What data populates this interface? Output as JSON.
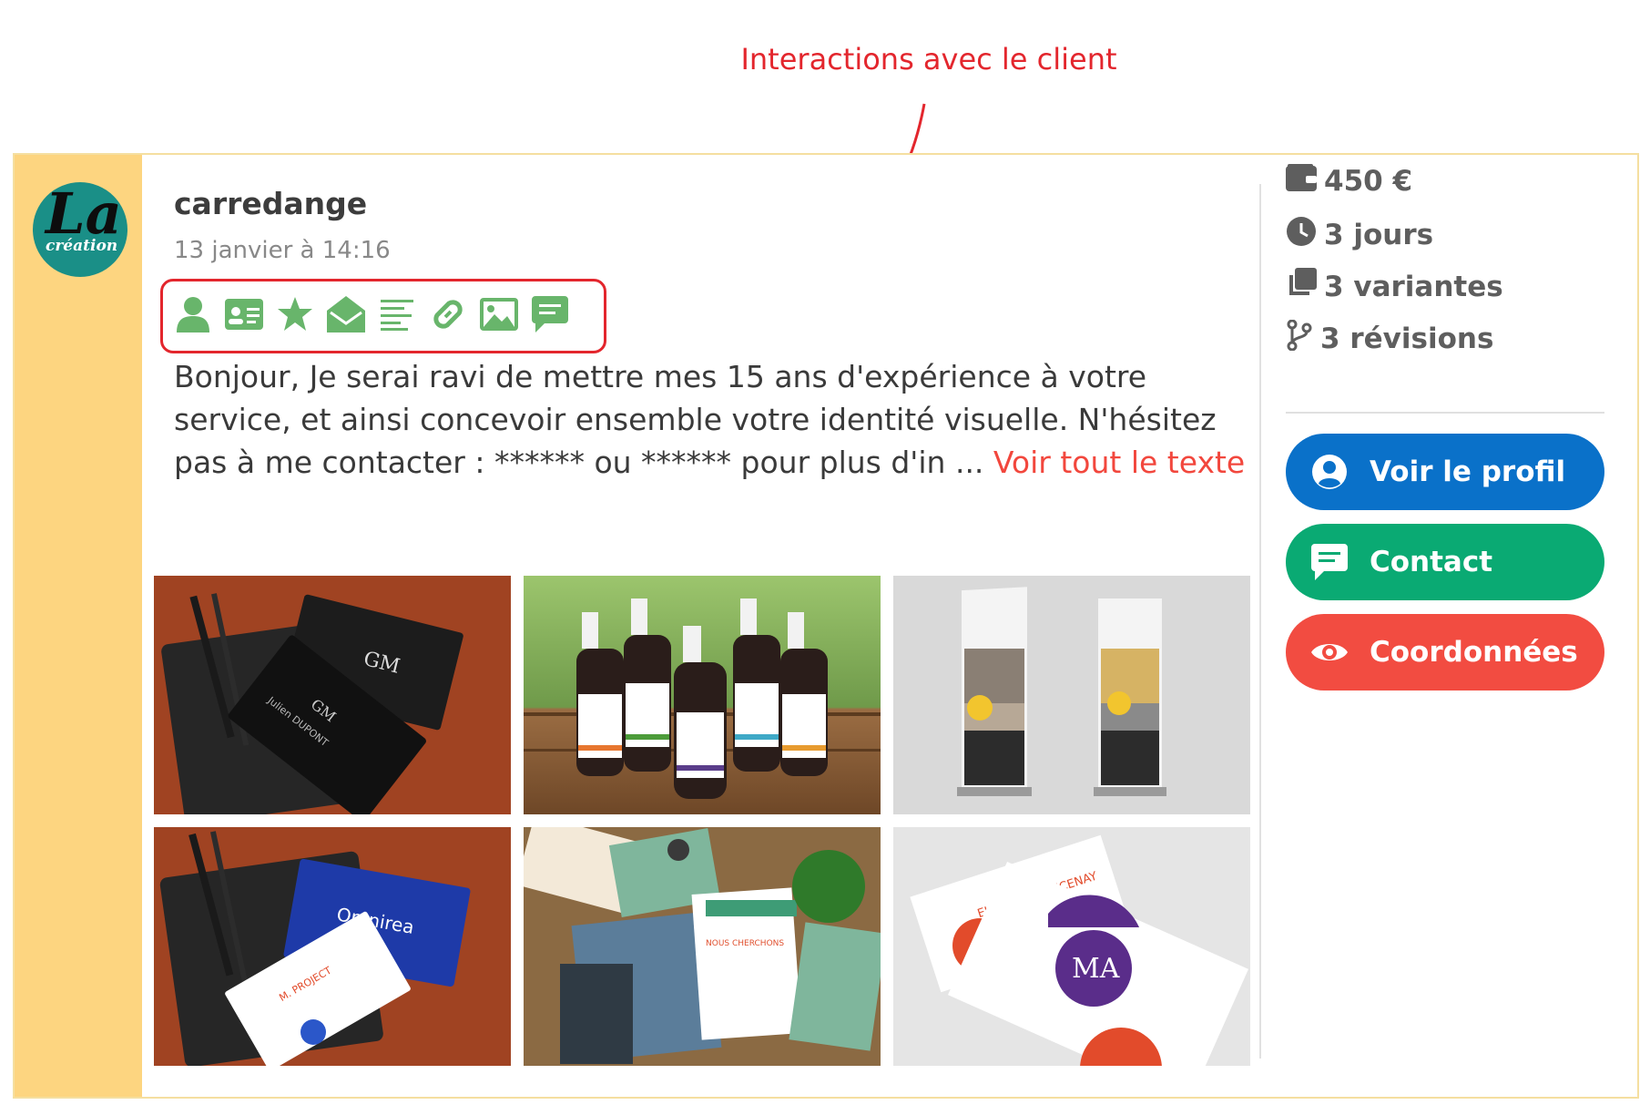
{
  "annotation": {
    "label": "Interactions avec le client"
  },
  "offer": {
    "username": "carredange",
    "date": "13 janvier à 14:16",
    "message": "Bonjour, Je serai ravi de mettre mes 15 ans d'expérience à votre service, et ainsi concevoir ensemble votre identité visuelle. N'hésitez pas à me contacter : ****** ou ****** pour plus d'in ... ",
    "read_more": "Voir tout le texte",
    "interaction_icons": [
      "user-icon",
      "id-card-icon",
      "star-icon",
      "envelope-open-icon",
      "text-lines-icon",
      "link-icon",
      "image-icon",
      "comment-icon"
    ],
    "icon_color": "#68b56b"
  },
  "stats": {
    "price": "450 €",
    "duration": "3 jours",
    "variants": "3 variantes",
    "revisions": "3 révisions"
  },
  "buttons": {
    "profile": {
      "label": "Voir le profil",
      "color": "#0a71c9"
    },
    "contact": {
      "label": "Contact",
      "color": "#0aaa73"
    },
    "coordinates": {
      "label": "Coordonnées",
      "color": "#f24c41"
    }
  },
  "colors": {
    "accent_red": "#e3262d",
    "stripe": "#fdd580"
  }
}
